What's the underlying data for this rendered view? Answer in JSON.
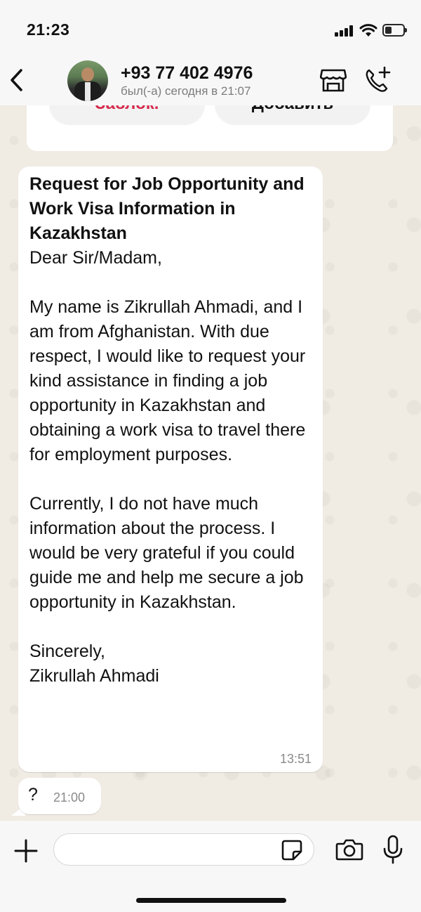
{
  "status_bar": {
    "time": "21:23"
  },
  "header": {
    "contact_name": "+93 77 402 4976",
    "last_seen": "был(-а) сегодня в 21:07"
  },
  "top_card": {
    "block_label": "Заблок.",
    "add_label": "Добавить"
  },
  "messages": [
    {
      "title": "Request for Job Opportunity and Work Visa Information in Kazakhstan",
      "body": "\nDear Sir/Madam,\n\nMy name is Zikrullah Ahmadi, and I am from Afghanistan. With due respect, I would like to request your kind assistance in finding a job opportunity in Kazakhstan and obtaining a work visa to travel there for employment purposes.\n\nCurrently, I do not have much information about the process. I would be very grateful if you could guide me and help me secure a job opportunity in Kazakhstan.\n\nSincerely,\nZikrullah Ahmadi",
      "time": "13:51"
    },
    {
      "body": "?",
      "time": "21:00"
    }
  ],
  "input_bar": {
    "placeholder": ""
  },
  "colors": {
    "block_red": "#d6284a",
    "background": "#efeae2",
    "bubble": "#ffffff"
  }
}
